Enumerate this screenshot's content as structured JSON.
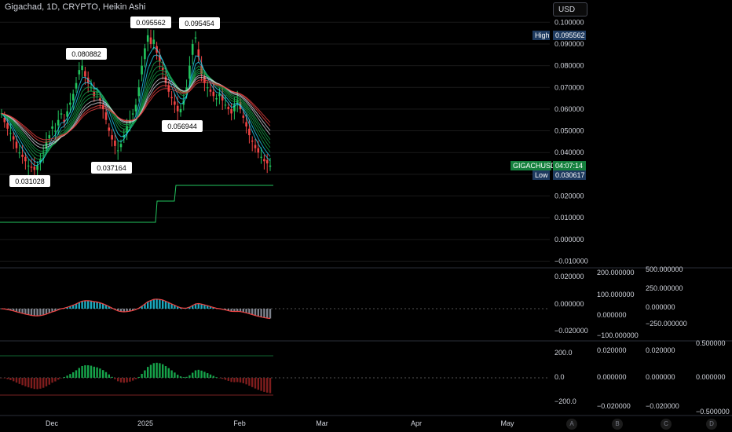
{
  "header": {
    "title": "Gigachad, 1D, CRYPTO, Heikin Ashi",
    "currency_button": "USD"
  },
  "colors": {
    "background": "#000000",
    "up": "#22c55e",
    "down": "#ef4444",
    "ribbon_up": "#16a34a",
    "ribbon_light": "#d1d5db",
    "ribbon_down": "#7f1d1d",
    "cyan": "#22d3ee",
    "price_tag": "#15803d",
    "high_low_tag": "#1e3a5f",
    "grid": "#1a1a1a"
  },
  "price_scale": {
    "ticks": [
      "0.100000",
      "0.090000",
      "0.080000",
      "0.070000",
      "0.060000",
      "0.050000",
      "0.040000",
      "0.030000",
      "0.020000",
      "0.010000",
      "0.000000",
      "−0.010000"
    ],
    "high_label": "High",
    "high_value": "0.095562",
    "symbol_label": "GIGACHUSD",
    "countdown": "04:07:14",
    "low_label": "Low",
    "low_value": "0.030617"
  },
  "macd_scale": {
    "ticks_a": [
      "0.020000",
      "0.000000",
      "−0.020000"
    ],
    "ticks_b": [
      "200.000000",
      "100.000000",
      "0.000000",
      "−100.000000"
    ],
    "ticks_c": [
      "500.000000",
      "250.000000",
      "0.000000",
      "−250.000000"
    ]
  },
  "osc_scale": {
    "ticks_a": [
      "200.0",
      "0.0",
      "−200.0"
    ],
    "ticks_b": [
      "0.020000",
      "0.000000",
      "−0.020000"
    ],
    "ticks_c": [
      "0.020000",
      "0.000000",
      "−0.020000"
    ],
    "ticks_d": [
      "0.500000",
      "0.000000",
      "−0.500000"
    ]
  },
  "time_axis": [
    "Dec",
    "2025",
    "Feb",
    "Mar",
    "Apr",
    "May"
  ],
  "scale_buttons": [
    "A",
    "B",
    "C",
    "D"
  ],
  "annotations": [
    "0.080882",
    "0.095562",
    "0.095454",
    "0.056944",
    "0.037164",
    "0.031028"
  ],
  "chart_data": {
    "type": "candlestick",
    "title": "Gigachad, 1D, CRYPTO, Heikin Ashi",
    "ylim": [
      -0.012,
      0.103
    ],
    "x_labels": [
      "Dec",
      "2025",
      "Feb",
      "Mar",
      "Apr",
      "May"
    ],
    "close": [
      0.058,
      0.054,
      0.051,
      0.049,
      0.046,
      0.042,
      0.04,
      0.038,
      0.036,
      0.034,
      0.033,
      0.032,
      0.034,
      0.037,
      0.04,
      0.045,
      0.048,
      0.052,
      0.05,
      0.055,
      0.058,
      0.054,
      0.059,
      0.063,
      0.067,
      0.072,
      0.078,
      0.08,
      0.075,
      0.072,
      0.07,
      0.066,
      0.068,
      0.064,
      0.06,
      0.055,
      0.05,
      0.046,
      0.043,
      0.041,
      0.044,
      0.048,
      0.052,
      0.055,
      0.058,
      0.062,
      0.07,
      0.08,
      0.088,
      0.094,
      0.09,
      0.092,
      0.086,
      0.082,
      0.078,
      0.072,
      0.068,
      0.065,
      0.062,
      0.059,
      0.06,
      0.064,
      0.07,
      0.08,
      0.09,
      0.093,
      0.084,
      0.076,
      0.072,
      0.07,
      0.068,
      0.066,
      0.065,
      0.067,
      0.064,
      0.062,
      0.06,
      0.058,
      0.062,
      0.064,
      0.06,
      0.056,
      0.052,
      0.048,
      0.045,
      0.042,
      0.04,
      0.038,
      0.036,
      0.035,
      0.034
    ],
    "series": [
      {
        "name": "",
        "type": "ribbon-ema"
      },
      {
        "name": "",
        "type": "macd-histogram"
      },
      {
        "name": "",
        "type": "oscillator"
      }
    ]
  }
}
